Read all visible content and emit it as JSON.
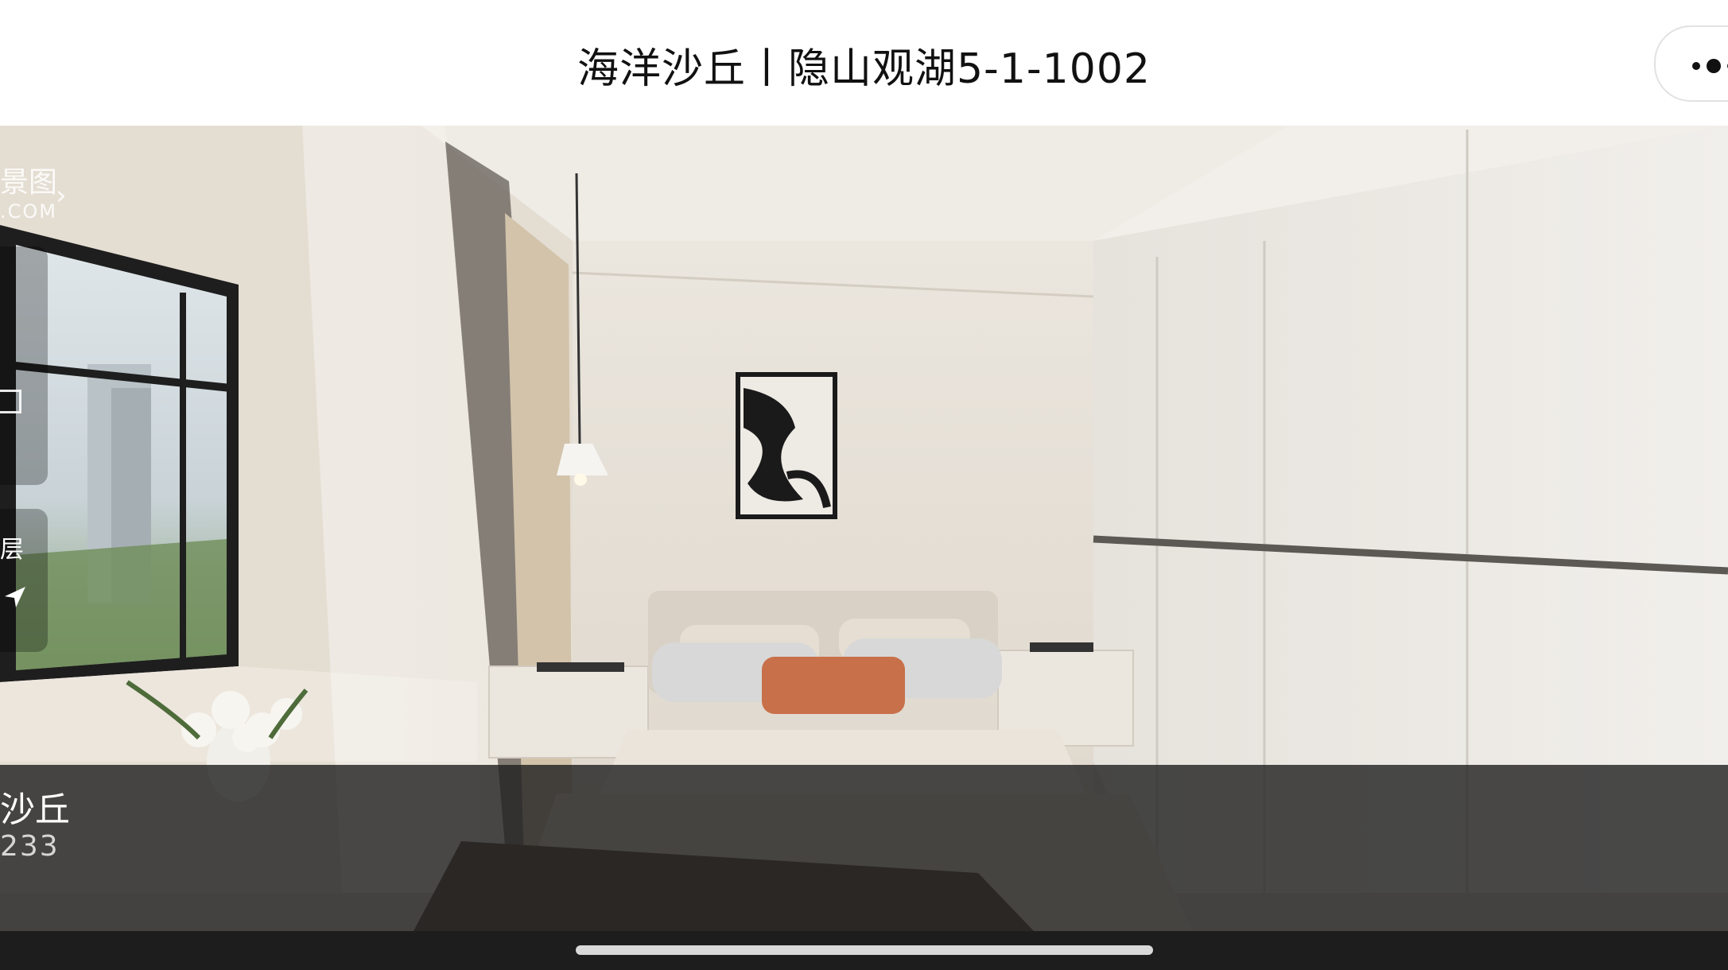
{
  "header": {
    "title": "海洋沙丘丨隐山观湖5-1-1002",
    "more_icon": "more-dots-icon"
  },
  "overlay": {
    "brand_name": "景图",
    "brand_domain": ".COM",
    "brand_chevron": "›",
    "floor_label": "层",
    "compass_icon": "navigation-arrow-icon"
  },
  "info": {
    "title": "沙丘",
    "subtitle": "233"
  },
  "colors": {
    "wall": "#e8e2d9",
    "wardrobe": "#eeebe6",
    "pillow_accent": "#c8704a",
    "overlay": "#1e1e1e"
  }
}
